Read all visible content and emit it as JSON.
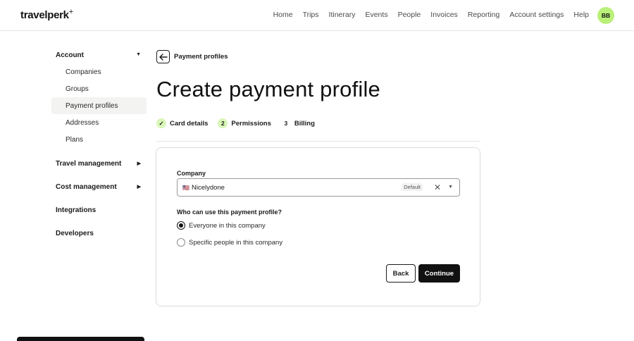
{
  "header": {
    "logo": "travelperk",
    "logo_mark": "+",
    "nav": [
      "Home",
      "Trips",
      "Itinerary",
      "Events",
      "People",
      "Invoices",
      "Reporting",
      "Account settings",
      "Help"
    ],
    "avatar_initials": "BB"
  },
  "sidebar": {
    "account": "Account",
    "account_items": [
      "Companies",
      "Groups",
      "Payment profiles",
      "Addresses",
      "Plans"
    ],
    "active_item": "Payment profiles",
    "travel_management": "Travel management",
    "cost_management": "Cost management",
    "integrations": "Integrations",
    "developers": "Developers"
  },
  "main": {
    "breadcrumb": "Payment profiles",
    "title": "Create payment profile",
    "steps": [
      {
        "label": "Card details",
        "marker": "✓",
        "state": "done"
      },
      {
        "label": "Permissions",
        "marker": "2",
        "state": "current"
      },
      {
        "label": "Billing",
        "marker": "3",
        "state": "upcoming"
      }
    ],
    "form": {
      "company_label": "Company",
      "company_flag": "🇺🇸",
      "company_value": "Nicelydone",
      "company_badge": "Default",
      "question": "Who can use this payment profile?",
      "option_everyone": "Everyone in this company",
      "option_specific": "Specific people in this company",
      "selected_option": "Everyone in this company",
      "back_label": "Back",
      "continue_label": "Continue"
    }
  },
  "colors": {
    "accent_green": "#b9f079",
    "step_green": "#d9f7b8",
    "primary_button": "#111111"
  }
}
